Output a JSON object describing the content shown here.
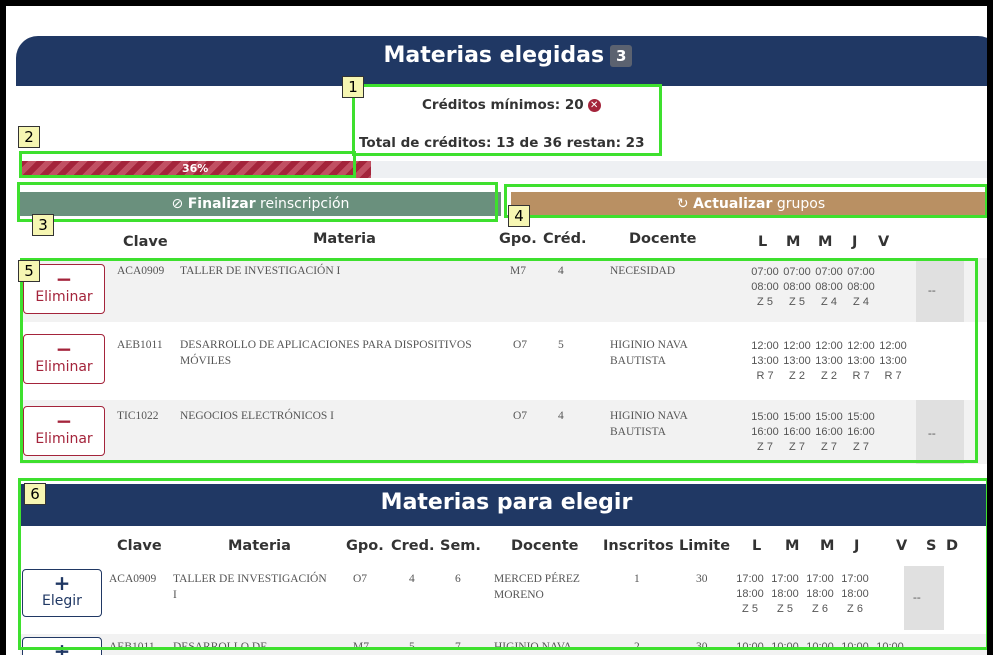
{
  "chosen": {
    "title": "Materias elegidas",
    "count": "3",
    "min_credits_label": "Créditos mínimos: 20",
    "total_credits_label": "Total de créditos: 13 de 36 restan: 23",
    "progress_fraction": 0.36,
    "progress_label": "36%",
    "finalize_bold": "Finalizar",
    "finalize_rest": " reinscripción",
    "update_bold": "Actualizar",
    "update_rest": " grupos",
    "headers": [
      "Clave",
      "Materia",
      "Gpo.",
      "Créd.",
      "Docente",
      "L",
      "M",
      "M",
      "J",
      "V"
    ],
    "remove_label": "Eliminar",
    "rows": [
      {
        "clave": "ACA0909",
        "materia": "TALLER DE INVESTIGACIÓN I",
        "gpo": "M7",
        "cred": "4",
        "docente": "NECESIDAD",
        "days": [
          [
            "07:00",
            "08:00",
            "Z 5"
          ],
          [
            "07:00",
            "08:00",
            "Z 5"
          ],
          [
            "07:00",
            "08:00",
            "Z 4"
          ],
          [
            "07:00",
            "08:00",
            "Z 4"
          ]
        ],
        "viernes": "--"
      },
      {
        "clave": "AEB1011",
        "materia": "DESARROLLO DE APLICACIONES PARA DISPOSITIVOS MÓVILES",
        "gpo": "O7",
        "cred": "5",
        "docente": "HIGINIO NAVA BAUTISTA",
        "days": [
          [
            "12:00",
            "13:00",
            "R 7"
          ],
          [
            "12:00",
            "13:00",
            "Z 2"
          ],
          [
            "12:00",
            "13:00",
            "Z 2"
          ],
          [
            "12:00",
            "13:00",
            "R 7"
          ],
          [
            "12:00",
            "13:00",
            "R 7"
          ]
        ],
        "viernes": ""
      },
      {
        "clave": "TIC1022",
        "materia": "NEGOCIOS ELECTRÓNICOS I",
        "gpo": "O7",
        "cred": "4",
        "docente": "HIGINIO NAVA BAUTISTA",
        "days": [
          [
            "15:00",
            "16:00",
            "Z 7"
          ],
          [
            "15:00",
            "16:00",
            "Z 7"
          ],
          [
            "15:00",
            "16:00",
            "Z 7"
          ],
          [
            "15:00",
            "16:00",
            "Z 7"
          ]
        ],
        "viernes": "--"
      }
    ]
  },
  "available": {
    "title": "Materias para elegir",
    "headers": [
      "Clave",
      "Materia",
      "Gpo.",
      "Cred.",
      "Sem.",
      "Docente",
      "Inscritos",
      "Limite",
      "L",
      "M",
      "M",
      "J",
      "V",
      "S",
      "D"
    ],
    "choose_label": "Elegir",
    "rows": [
      {
        "clave": "ACA0909",
        "materia": "TALLER DE INVESTIGACIÓN I",
        "gpo": "O7",
        "cred": "4",
        "sem": "6",
        "docente": "MERCED PÉREZ MORENO",
        "inscritos": "1",
        "limite": "30",
        "days": [
          [
            "17:00",
            "18:00",
            "Z 5"
          ],
          [
            "17:00",
            "18:00",
            "Z 5"
          ],
          [
            "17:00",
            "18:00",
            "Z 6"
          ],
          [
            "17:00",
            "18:00",
            "Z 6"
          ]
        ],
        "viernes": "--"
      },
      {
        "clave": "AEB1011",
        "materia": "DESARROLLO DE",
        "gpo": "M7",
        "cred": "5",
        "sem": "7",
        "docente": "HIGINIO NAVA",
        "inscritos": "2",
        "limite": "30",
        "days": [
          [
            "10:00"
          ],
          [
            "10:00"
          ],
          [
            "10:00"
          ],
          [
            "10:00"
          ],
          [
            "10:00"
          ]
        ],
        "viernes": ""
      }
    ]
  },
  "callouts": [
    "1",
    "2",
    "3",
    "4",
    "5",
    "6"
  ],
  "colors": {
    "navy": "#203864",
    "crimson": "#a4243b",
    "green_btn": "#6a907d",
    "tan_btn": "#b99063",
    "callout": "#3ee02e"
  }
}
